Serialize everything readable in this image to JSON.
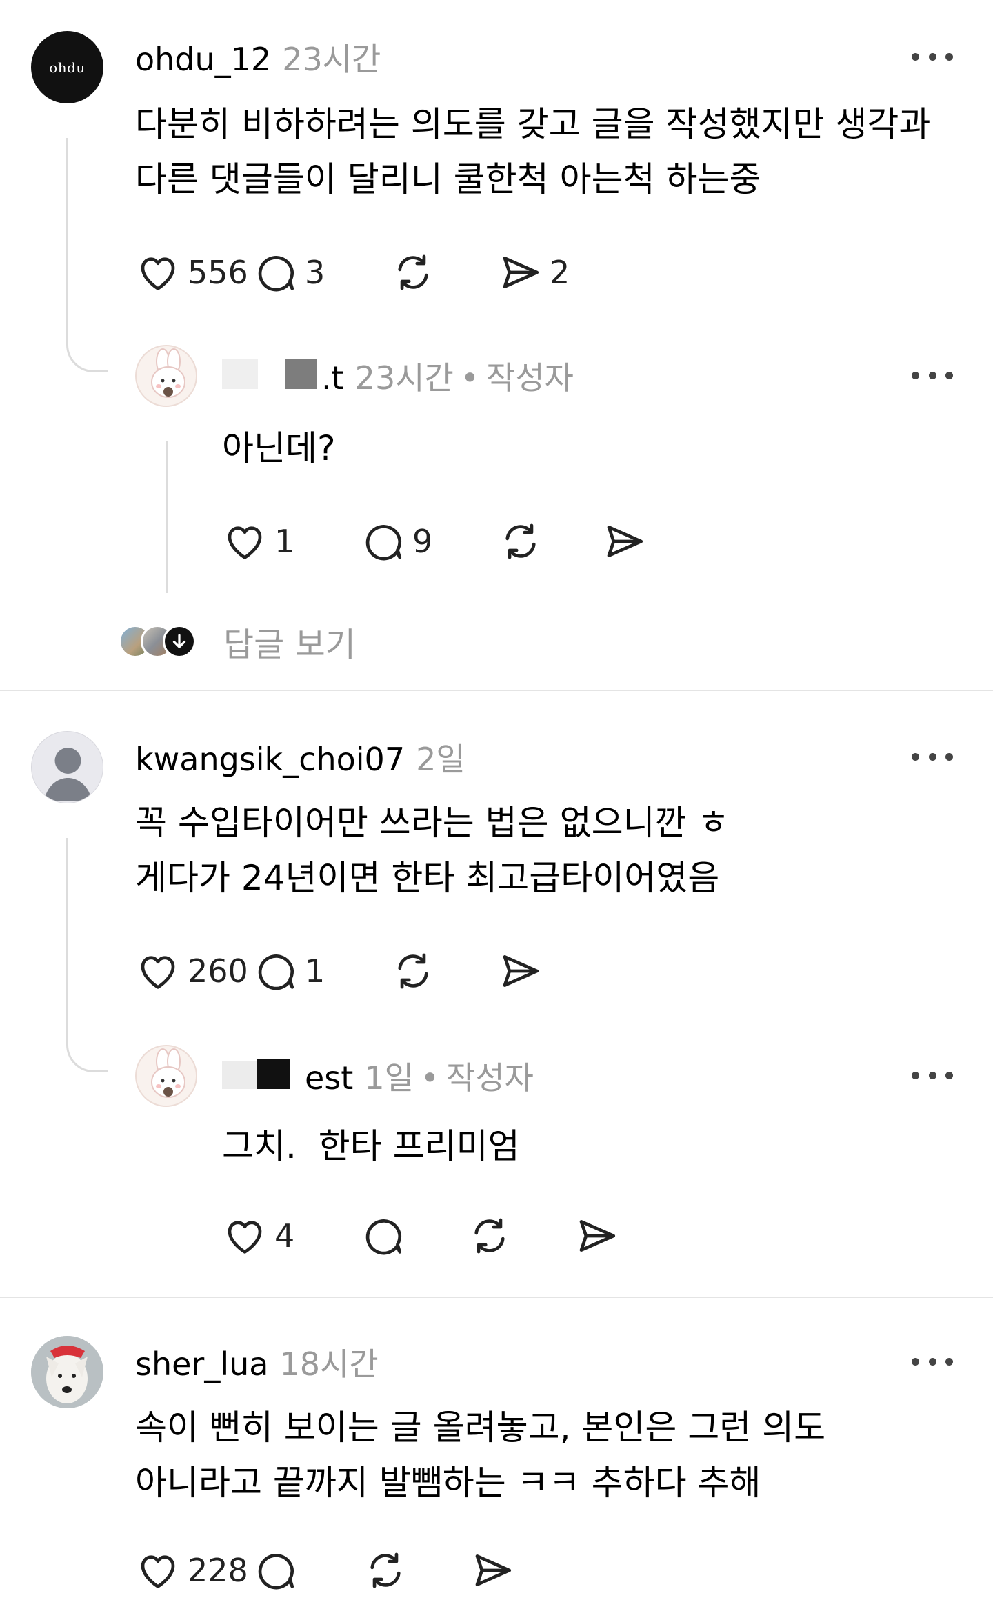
{
  "comments": [
    {
      "username": "ohdu_12",
      "avatar_text": "ohdu",
      "time": "23시간",
      "text_line1": "다분히 비하하려는 의도를 갖고 글을 작성했지만 생각과",
      "text_line2": "다른 댓글들이 달리니 쿨한척 아는척 하는중",
      "likes": "556",
      "replies": "3",
      "shares": "2",
      "reply": {
        "username_fragment": ".t",
        "time": "23시간",
        "author_badge": "작성자",
        "text": "아닌데?",
        "likes": "1",
        "replies": "9"
      },
      "see_replies_label": "답글 보기"
    },
    {
      "username": "kwangsik_choi07",
      "time": "2일",
      "text_line1": "꼭 수입타이어만 쓰라는 법은 없으니깐 ㅎ",
      "text_line2": "게다가 24년이면 한타 최고급타이어였음",
      "likes": "260",
      "replies": "1",
      "reply": {
        "username_fragment": "est",
        "time": "1일",
        "author_badge": "작성자",
        "text": "그치.  한타 프리미엄",
        "likes": "4"
      }
    },
    {
      "username": "sher_lua",
      "time": "18시간",
      "text_line1": "속이 뻔히 보이는 글 올려놓고, 본인은 그런 의도",
      "text_line2": "아니라고 끝까지 발뺌하는 ㅋㅋ 추하다 추해",
      "likes": "228"
    }
  ],
  "icons": {
    "like": "heart-icon",
    "comment": "comment-bubble-icon",
    "repost": "repost-icon",
    "share": "send-icon",
    "more": "more-options-icon"
  }
}
